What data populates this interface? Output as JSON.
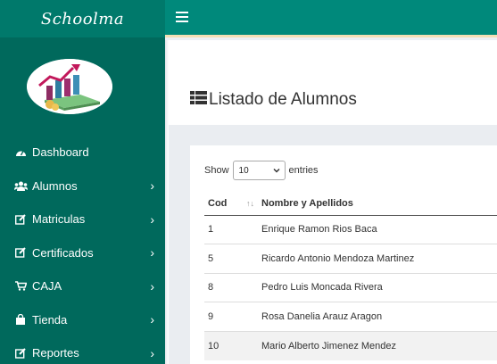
{
  "app": {
    "brand": "Schoolma"
  },
  "sidebar": {
    "items": [
      {
        "label": "Dashboard",
        "icon": "dashboard-icon",
        "has_submenu": false
      },
      {
        "label": "Alumnos",
        "icon": "users-icon",
        "has_submenu": true
      },
      {
        "label": "Matriculas",
        "icon": "edit-icon",
        "has_submenu": true
      },
      {
        "label": "Certificados",
        "icon": "edit-icon",
        "has_submenu": true
      },
      {
        "label": "CAJA",
        "icon": "cart-icon",
        "has_submenu": true
      },
      {
        "label": "Tienda",
        "icon": "bag-icon",
        "has_submenu": true
      },
      {
        "label": "Reportes",
        "icon": "edit-icon",
        "has_submenu": true
      }
    ]
  },
  "page": {
    "title": "Listado de Alumnos"
  },
  "table_controls": {
    "show_label": "Show",
    "entries_label": "entries",
    "page_size": "10"
  },
  "table": {
    "columns": [
      "Cod",
      "Nombre y Apellidos"
    ],
    "rows": [
      {
        "cod": "1",
        "nombre": "Enrique Ramon Rios Baca"
      },
      {
        "cod": "5",
        "nombre": "Ricardo Antonio Mendoza Martinez"
      },
      {
        "cod": "8",
        "nombre": "Pedro Luis Moncada Rivera"
      },
      {
        "cod": "9",
        "nombre": "Rosa Danelia Arauz Aragon"
      },
      {
        "cod": "10",
        "nombre": "Mario Alberto Jimenez Mendez"
      }
    ]
  },
  "colors": {
    "sidebar": "#00695c",
    "topbar": "#00897b",
    "accent_border": "#f3dfb6"
  }
}
